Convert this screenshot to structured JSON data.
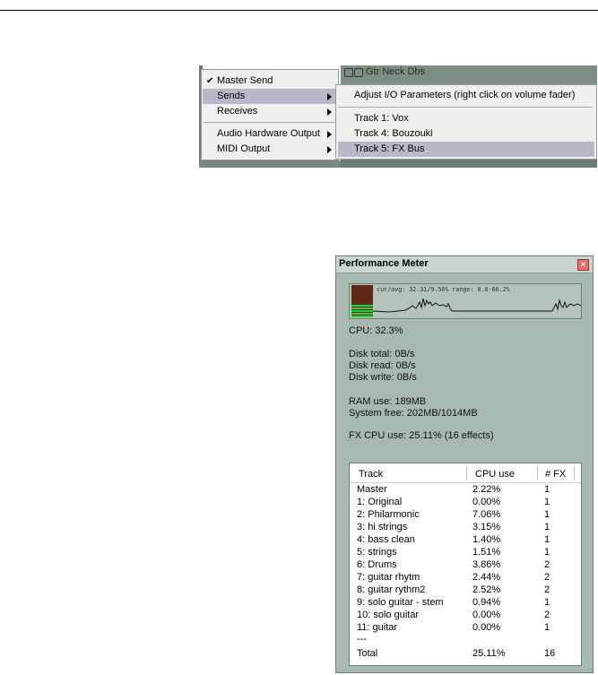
{
  "context_menu": {
    "track_header": "Gtr Neck Dbs",
    "items": [
      {
        "label": "Master Send",
        "checked": true,
        "submenu": false
      },
      {
        "label": "Sends",
        "checked": false,
        "submenu": true,
        "highlighted": true
      },
      {
        "label": "Receives",
        "checked": false,
        "submenu": true
      },
      {
        "label": "Audio Hardware Output",
        "checked": false,
        "submenu": true
      },
      {
        "label": "MIDI Output",
        "checked": false,
        "submenu": true
      }
    ],
    "check_glyph": "✔",
    "sends_submenu": [
      {
        "label": "Adjust I/O Parameters  (right click on volume fader)"
      },
      {
        "label": "Track 1: Vox"
      },
      {
        "label": "Track 4: Bouzouki"
      },
      {
        "label": "Track 5: FX Bus",
        "highlighted": true
      }
    ]
  },
  "performance_meter": {
    "title": "Performance Meter",
    "close_glyph": "✕",
    "graph_caption": "cur/avg: 32.31/9.56%  range: 0.0-66.2%",
    "cpu": "CPU: 32.3%",
    "disk_total": "Disk total: 0B/s",
    "disk_read": "Disk read: 0B/s",
    "disk_write": "Disk write: 0B/s",
    "ram_use": "RAM use: 189MB",
    "system_free": "System free: 202MB/1014MB",
    "fx_cpu": "FX CPU use: 25.11% (16 effects)",
    "table": {
      "headers": [
        "Track",
        "CPU use",
        "# FX"
      ],
      "rows": [
        [
          "Master",
          "2.22%",
          "1"
        ],
        [
          "1: Original",
          "0.00%",
          "1"
        ],
        [
          "2: Philarmonic",
          "7.06%",
          "1"
        ],
        [
          "3: hi strings",
          "3.15%",
          "1"
        ],
        [
          "4: bass clean",
          "1.40%",
          "1"
        ],
        [
          "5: strings",
          "1.51%",
          "1"
        ],
        [
          "6: Drums",
          "3.86%",
          "2"
        ],
        [
          "7: guitar rhytm",
          "2.44%",
          "2"
        ],
        [
          "8: guitar rythm2",
          "2.52%",
          "2"
        ],
        [
          "9: solo guitar - stem",
          "0.94%",
          "1"
        ],
        [
          "10: solo guitar",
          "0.00%",
          "2"
        ],
        [
          "11: guitar",
          "0.00%",
          "1"
        ],
        [
          "---",
          "",
          ""
        ],
        [
          "Total",
          "25.11%",
          "16"
        ]
      ]
    }
  }
}
